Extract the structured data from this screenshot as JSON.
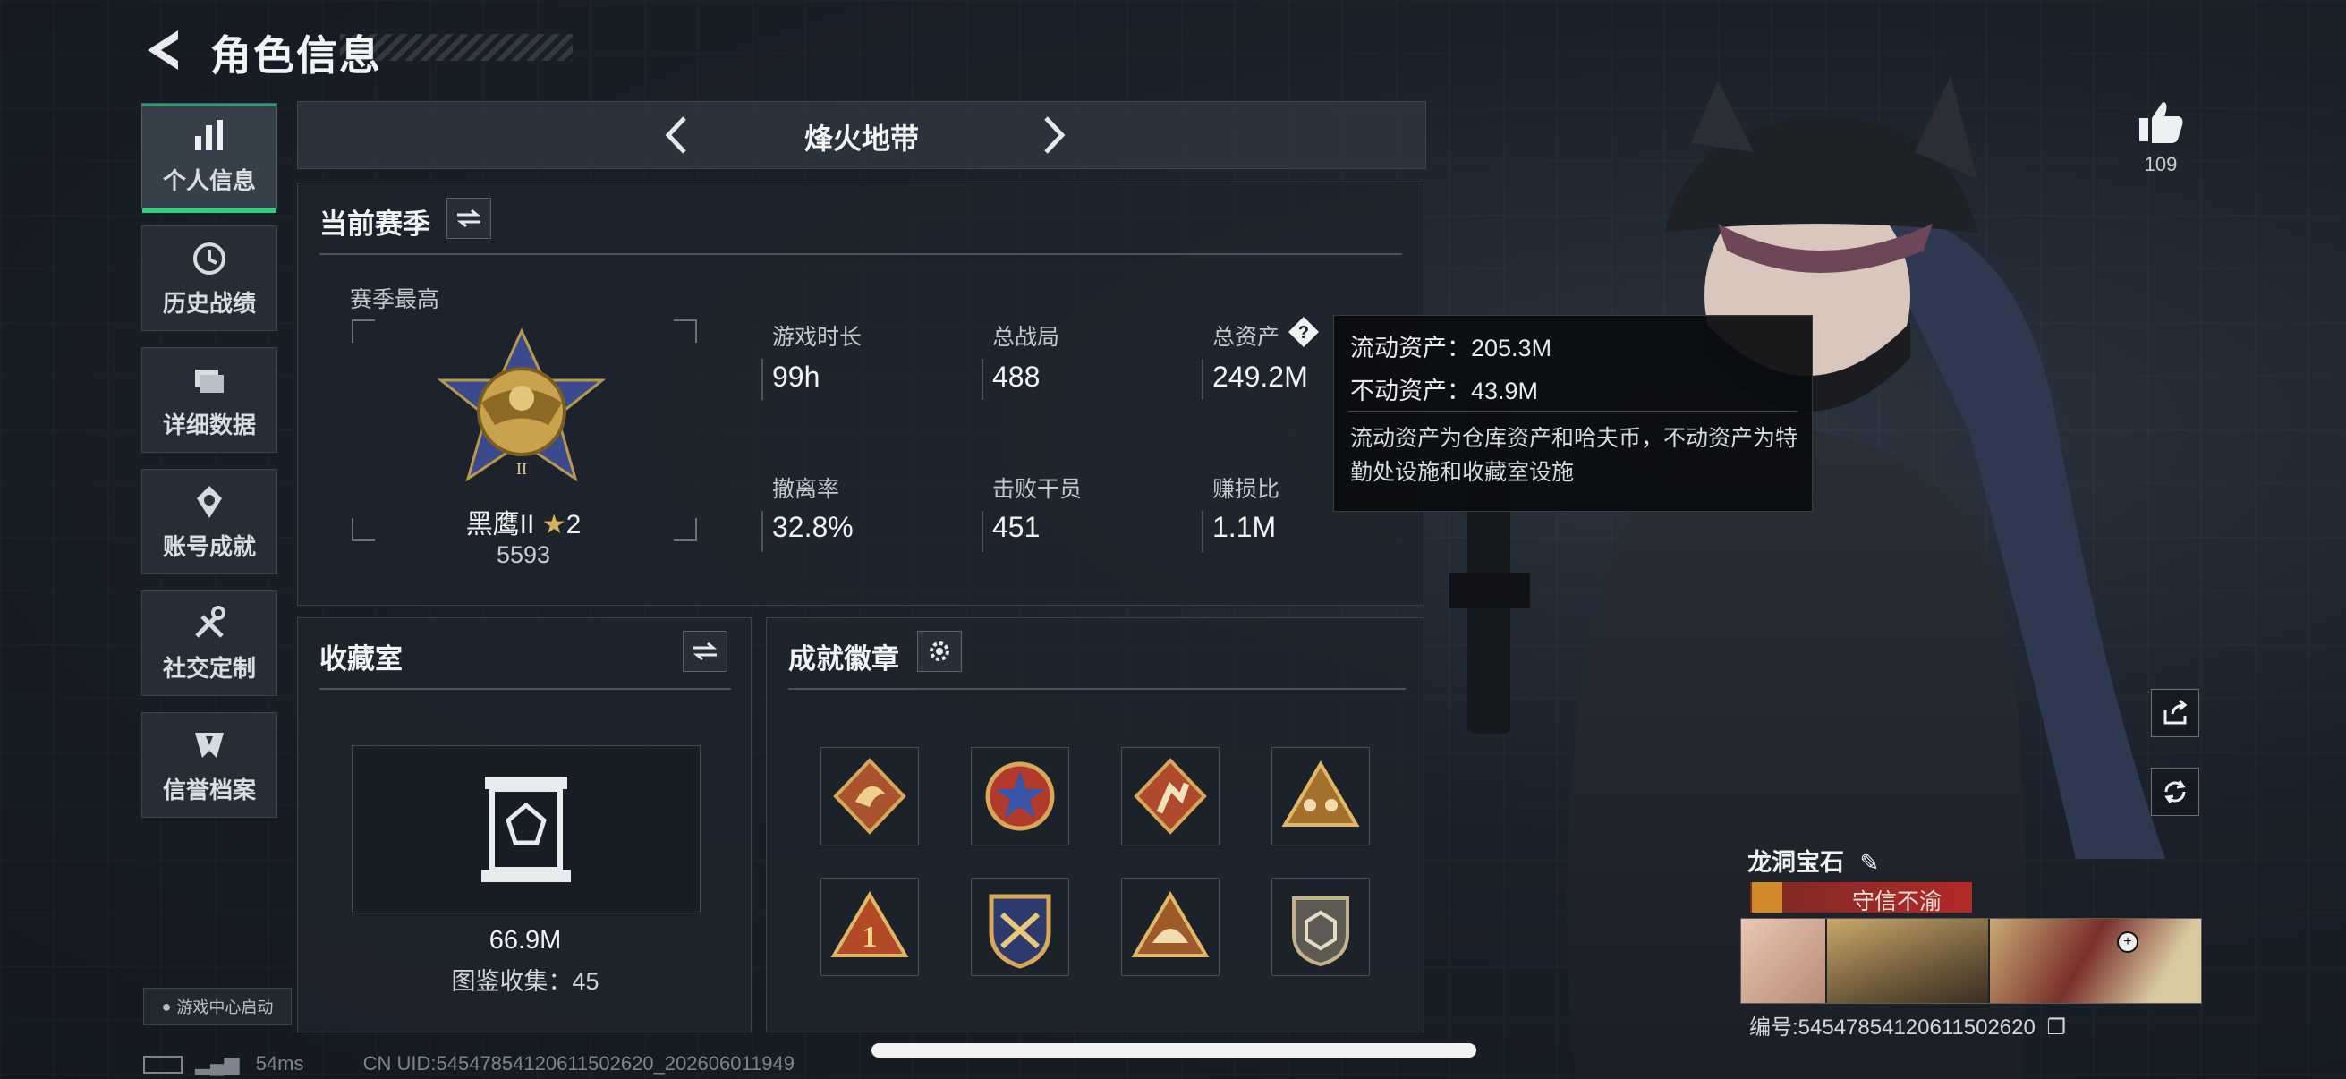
{
  "header": {
    "title": "角色信息"
  },
  "sidebar": {
    "items": [
      {
        "label": "个人信息",
        "icon": "bar-chart-icon",
        "active": true
      },
      {
        "label": "历史战绩",
        "icon": "history-icon"
      },
      {
        "label": "详细数据",
        "icon": "folder-icon"
      },
      {
        "label": "账号成就",
        "icon": "trophy-icon"
      },
      {
        "label": "社交定制",
        "icon": "tools-icon"
      },
      {
        "label": "信誉档案",
        "icon": "shield-icon"
      }
    ],
    "game_center": "游戏中心启动"
  },
  "mode": {
    "name": "烽火地带"
  },
  "season": {
    "title": "当前赛季",
    "best_label": "赛季最高",
    "rank_name": "黑鹰II",
    "rank_stars": "2",
    "rank_score": "5593",
    "stats": [
      {
        "label": "游戏时长",
        "value": "99h"
      },
      {
        "label": "总战局",
        "value": "488"
      },
      {
        "label": "总资产",
        "value": "249.2M"
      },
      {
        "label": "撤离率",
        "value": "32.8%"
      },
      {
        "label": "击败干员",
        "value": "451"
      },
      {
        "label": "赚损比",
        "value": "1.1M"
      }
    ]
  },
  "tooltip": {
    "liquid": "流动资产：205.3M",
    "fixed": "不动资产：43.9M",
    "note": "流动资产为仓库资产和哈夫币，不动资产为特勤处设施和收藏室设施"
  },
  "collection": {
    "title": "收藏室",
    "value": "66.9M",
    "count_line": "图鉴收集：45"
  },
  "achievements": {
    "title": "成就徽章",
    "badges": [
      "dragon-badge",
      "star-medal-badge",
      "runner-badge",
      "squad-badge",
      "number-one-badge",
      "crossed-guns-badge",
      "helmet-badge",
      "dice-badge"
    ]
  },
  "like": {
    "count": "109"
  },
  "player": {
    "name": "龙洞宝石",
    "honor": "守信不渝",
    "uid_line": "编号:545478541206115026​20"
  },
  "status": {
    "ping": "54ms",
    "cn_uid": "CN UID:54547854120611502620_202606011949"
  },
  "colors": {
    "accent_green": "#2fd27a",
    "honor_red": "#b22a2a"
  }
}
